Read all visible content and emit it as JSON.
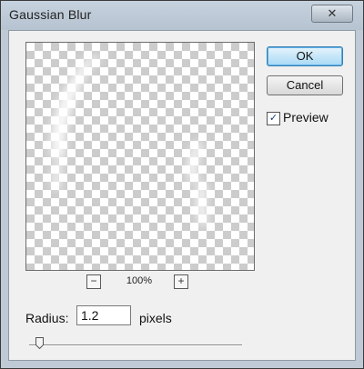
{
  "window": {
    "title": "Gaussian Blur",
    "close_icon": "close-icon"
  },
  "preview": {
    "zoom_level": "100%",
    "zoom_out_label": "−",
    "zoom_in_label": "+",
    "background": "transparency-checkerboard"
  },
  "buttons": {
    "ok_label": "OK",
    "cancel_label": "Cancel"
  },
  "preview_toggle": {
    "label": "Preview",
    "checked": true
  },
  "radius": {
    "label": "Radius:",
    "value": "1.2",
    "unit": "pixels"
  },
  "slider": {
    "value_fraction": 0.05
  },
  "colors": {
    "default_button": "#a7d9f5",
    "titlebar": "#bfcad6"
  }
}
